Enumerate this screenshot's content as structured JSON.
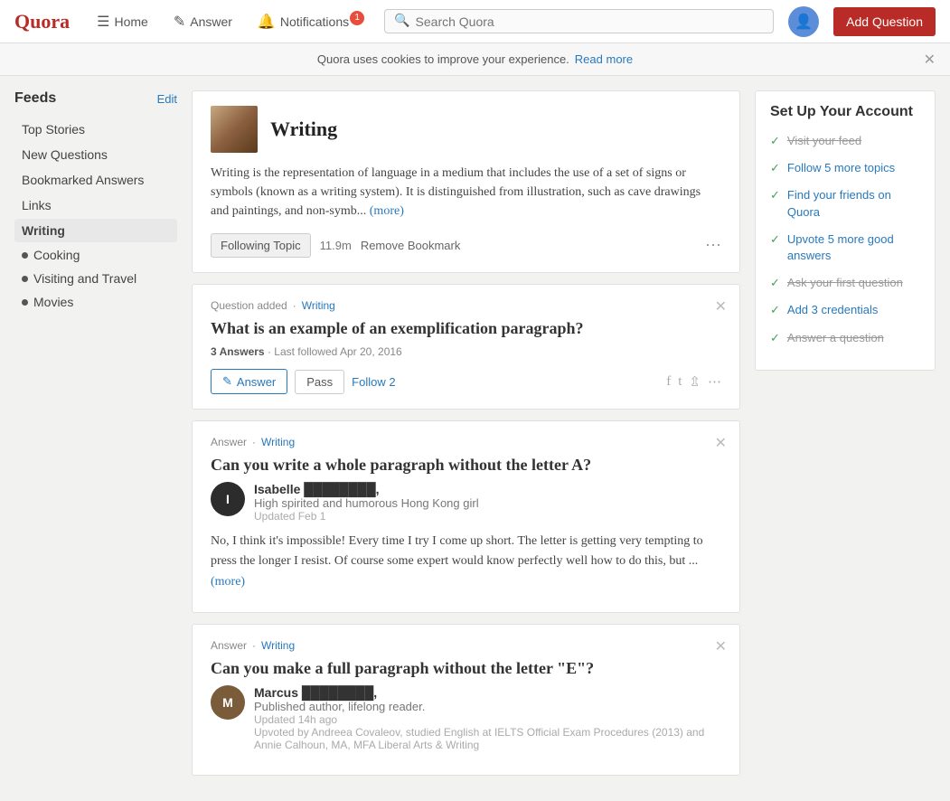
{
  "navbar": {
    "logo": "Quora",
    "home_label": "Home",
    "answer_label": "Answer",
    "notifications_label": "Notifications",
    "notifications_count": "1",
    "search_placeholder": "Search Quora",
    "add_question_label": "Add Question"
  },
  "cookie_banner": {
    "message": "Quora uses cookies to improve your experience.",
    "read_more": "Read more"
  },
  "sidebar": {
    "feeds_title": "Feeds",
    "edit_label": "Edit",
    "nav_items": [
      {
        "label": "Top Stories"
      },
      {
        "label": "New Questions"
      },
      {
        "label": "Bookmarked Answers"
      },
      {
        "label": "Links"
      },
      {
        "label": "Writing",
        "active": true
      }
    ],
    "topic_items": [
      {
        "label": "Cooking"
      },
      {
        "label": "Visiting and Travel"
      },
      {
        "label": "Movies"
      }
    ]
  },
  "writing_topic": {
    "title": "Writing",
    "description": "Writing is the representation of language in a medium that includes the use of a set of signs or symbols (known as a writing system). It is distinguished from illustration, such as cave drawings and paintings, and non-symb...",
    "more_link": "(more)",
    "following_label": "Following Topic",
    "follower_count": "11.9m",
    "remove_bookmark": "Remove Bookmark"
  },
  "question_card": {
    "meta_prefix": "Question added",
    "meta_topic": "Writing",
    "title": "What is an example of an exemplification paragraph?",
    "answers_count": "3 Answers",
    "last_followed": "Last followed Apr 20, 2016",
    "answer_btn": "Answer",
    "pass_btn": "Pass",
    "follow_btn": "Follow",
    "follow_count": "2"
  },
  "answer_card_1": {
    "meta_prefix": "Answer",
    "meta_topic": "Writing",
    "title": "Can you write a whole paragraph without the letter A?",
    "author_name": "Isabelle",
    "author_name_redacted": "Isabelle ████████,",
    "author_title": "High spirited and humorous Hong Kong girl",
    "author_date": "Updated Feb 1",
    "answer_text": "No, I think it's impossible! Every time I try I come up short. The letter is getting very tempting to press the longer I resist. Of course some expert would know perfectly well how to do this, but ...",
    "more_link": "(more)"
  },
  "answer_card_2": {
    "meta_prefix": "Answer",
    "meta_topic": "Writing",
    "title": "Can you make a full paragraph without the letter \"E\"?",
    "author_name": "Marcus",
    "author_name_redacted": "Marcus ████████,",
    "author_title": "Published author, lifelong reader.",
    "author_date": "Updated 14h ago",
    "upvote_text": "Upvoted by Andreea Covaleov, studied English at IELTS Official Exam Procedures (2013) and Annie Calhoun, MA, MFA Liberal Arts & Writing"
  },
  "setup_account": {
    "title": "Set Up Your Account",
    "items": [
      {
        "label": "Visit your feed",
        "done": true
      },
      {
        "label": "Follow 5 more topics",
        "done": false
      },
      {
        "label": "Find your friends on Quora",
        "done": false
      },
      {
        "label": "Upvote 5 more good answers",
        "done": false
      },
      {
        "label": "Ask your first question",
        "done": true
      },
      {
        "label": "Add 3 credentials",
        "done": false
      },
      {
        "label": "Answer a question",
        "done": true
      }
    ]
  }
}
